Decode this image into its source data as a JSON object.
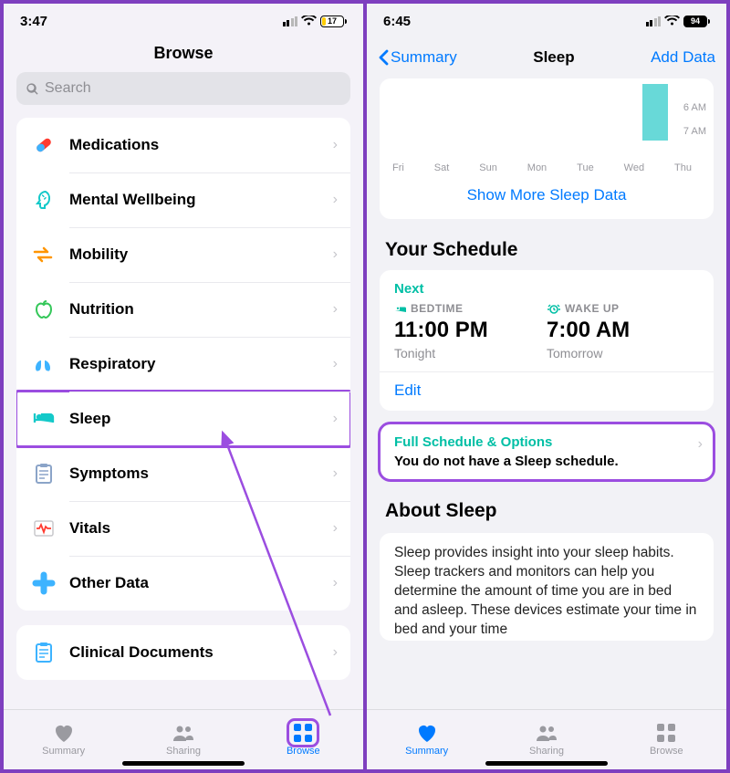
{
  "left": {
    "status": {
      "time": "3:47",
      "battery_pct": 17
    },
    "title": "Browse",
    "search_placeholder": "Search",
    "categories": [
      {
        "id": "medications",
        "label": "Medications"
      },
      {
        "id": "mental-wellbeing",
        "label": "Mental Wellbeing"
      },
      {
        "id": "mobility",
        "label": "Mobility"
      },
      {
        "id": "nutrition",
        "label": "Nutrition"
      },
      {
        "id": "respiratory",
        "label": "Respiratory"
      },
      {
        "id": "sleep",
        "label": "Sleep"
      },
      {
        "id": "symptoms",
        "label": "Symptoms"
      },
      {
        "id": "vitals",
        "label": "Vitals"
      },
      {
        "id": "other-data",
        "label": "Other Data"
      }
    ],
    "secondary": [
      {
        "id": "clinical-documents",
        "label": "Clinical Documents"
      }
    ],
    "tabs": {
      "summary": "Summary",
      "sharing": "Sharing",
      "browse": "Browse"
    }
  },
  "right": {
    "status": {
      "time": "6:45",
      "battery_pct": 94
    },
    "nav": {
      "back": "Summary",
      "title": "Sleep",
      "action": "Add Data"
    },
    "chart": {
      "days": [
        "Fri",
        "Sat",
        "Sun",
        "Mon",
        "Tue",
        "Wed",
        "Thu"
      ],
      "time_labels": [
        "6 AM",
        "7 AM"
      ]
    },
    "show_more": "Show More Sleep Data",
    "schedule": {
      "heading": "Your Schedule",
      "next_label": "Next",
      "bedtime_label": "BEDTIME",
      "bedtime": "11:00 PM",
      "bedtime_day": "Tonight",
      "wake_label": "WAKE UP",
      "wake": "7:00 AM",
      "wake_day": "Tomorrow",
      "edit": "Edit"
    },
    "full": {
      "title": "Full Schedule & Options",
      "subtitle": "You do not have a Sleep schedule."
    },
    "about": {
      "heading": "About Sleep",
      "body": "Sleep provides insight into your sleep habits. Sleep trackers and monitors can help you determine the amount of time you are in bed and asleep. These devices estimate your time in bed and your time"
    },
    "tabs": {
      "summary": "Summary",
      "sharing": "Sharing",
      "browse": "Browse"
    }
  },
  "colors": {
    "accent_blue": "#007aff",
    "accent_teal": "#00bfa5",
    "highlight_purple": "#9b4de0",
    "battery_yellow": "#ffcc00"
  }
}
